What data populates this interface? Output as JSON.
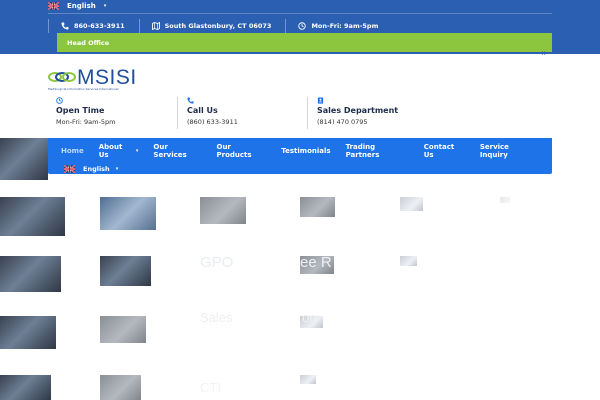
{
  "topbar": {
    "language": "English",
    "phone": "860-633-3911",
    "address": "South Glastonbury, CT 06073",
    "hours": "Mon-Fri: 9am-5pm",
    "head_office_label": "Head Office",
    "close_symbol": "×"
  },
  "logo": {
    "name": "MSISI",
    "tagline": "MedSurgical Information Services International"
  },
  "info": {
    "open_time": {
      "title": "Open Time",
      "value": "Mon-Fri: 9am-5pm"
    },
    "call_us": {
      "title": "Call Us",
      "value": "(860) 633-3911"
    },
    "sales": {
      "title": "Sales Department",
      "value": "(814) 470 0795"
    }
  },
  "nav": {
    "items": [
      {
        "label": "Home"
      },
      {
        "label": "About Us"
      },
      {
        "label": "Our Services"
      },
      {
        "label": "Our Products"
      },
      {
        "label": "Testimonials"
      },
      {
        "label": "Trading Partners"
      },
      {
        "label": "Contact Us"
      },
      {
        "label": "Service Inquiry"
      }
    ],
    "language": "English"
  },
  "hero": {
    "line1_a": "GPO",
    "line1_b": "ee R",
    "line2_a": "Sales",
    "line2_b": "on",
    "line3": "CTI"
  },
  "colors": {
    "topbar": "#2b5fb1",
    "head_office": "#8cc63f",
    "nav": "#1e73e8",
    "text_dark": "#1d2c4a"
  }
}
